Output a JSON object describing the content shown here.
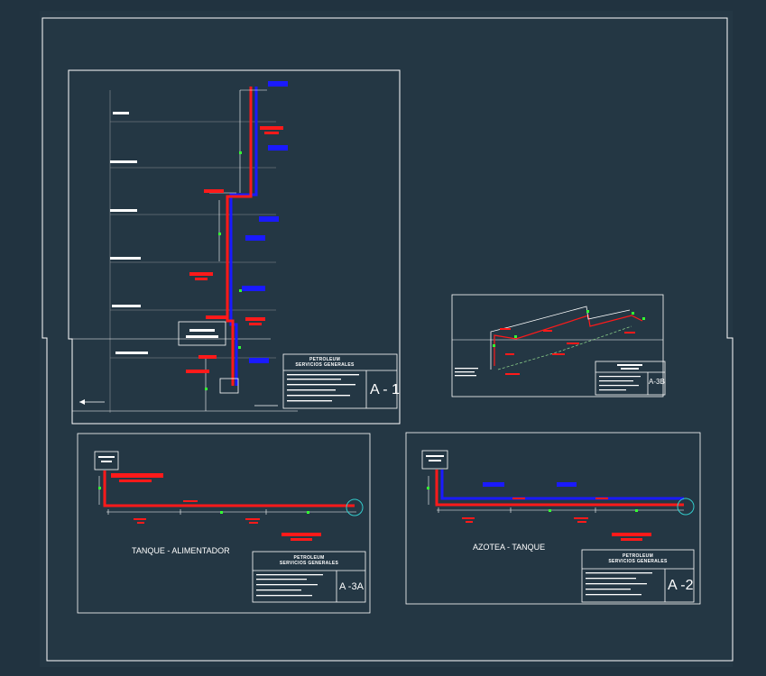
{
  "colors": {
    "background": "#213340",
    "frame": "#ffffff",
    "pipe_red": "#ff1a1a",
    "pipe_blue": "#1a1aff",
    "valve_green": "#33ff33",
    "circle_cyan": "#33cccc",
    "level_grey": "#8a8f96",
    "dashed_green": "#88cc88"
  },
  "sheets": {
    "a1": {
      "code": "A - 1",
      "company": "PETROLEUM",
      "subtitle": "SERVICIOS GENERALES"
    },
    "a3b": {
      "code": "A-3B"
    },
    "a3a": {
      "code": "A -3A",
      "company": "PETROLEUM",
      "subtitle": "SERVICIOS GENERALES",
      "caption": "TANQUE - ALIMENTADOR"
    },
    "a2": {
      "code": "A -2",
      "company": "PETROLEUM",
      "subtitle": "SERVICIOS GENERALES",
      "caption": "AZOTEA - TANQUE"
    }
  }
}
